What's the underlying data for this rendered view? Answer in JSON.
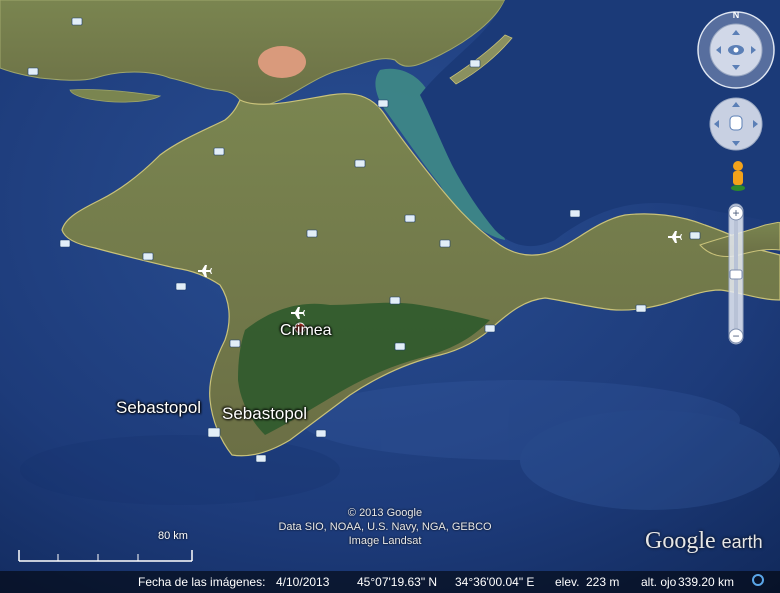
{
  "map": {
    "place_labels": {
      "crimea": "Crimea",
      "sebastopol_left": "Sebastopol",
      "sebastopol_right": "Sebastopol"
    },
    "colors": {
      "sea": "#1d3b7a",
      "land": "#6e7a4a",
      "forest": "#2f5a2c",
      "shallow": "#3f8a86"
    }
  },
  "attribution": {
    "line1": "© 2013 Google",
    "line2": "Data SIO, NOAA, U.S. Navy, NGA, GEBCO",
    "line3": "Image Landsat"
  },
  "scale": {
    "label": "80 km"
  },
  "brand": {
    "google": "Google",
    "earth": "earth"
  },
  "status_bar": {
    "imagery_date_label": "Fecha de las imágenes:",
    "imagery_date": "4/10/2013",
    "latitude": "45°07'19.63\" N",
    "longitude": "34°36'00.04\" E",
    "elevation_label": "elev.",
    "elevation": "223 m",
    "eye_altitude_label": "alt. ojo",
    "eye_altitude": "339.20 km"
  },
  "controls": {
    "compass_north": "N",
    "zoom_in": "+",
    "zoom_out": "−",
    "icons": [
      "look-joystick-icon",
      "move-hand-icon",
      "street-view-pegman-icon",
      "zoom-slider"
    ]
  }
}
